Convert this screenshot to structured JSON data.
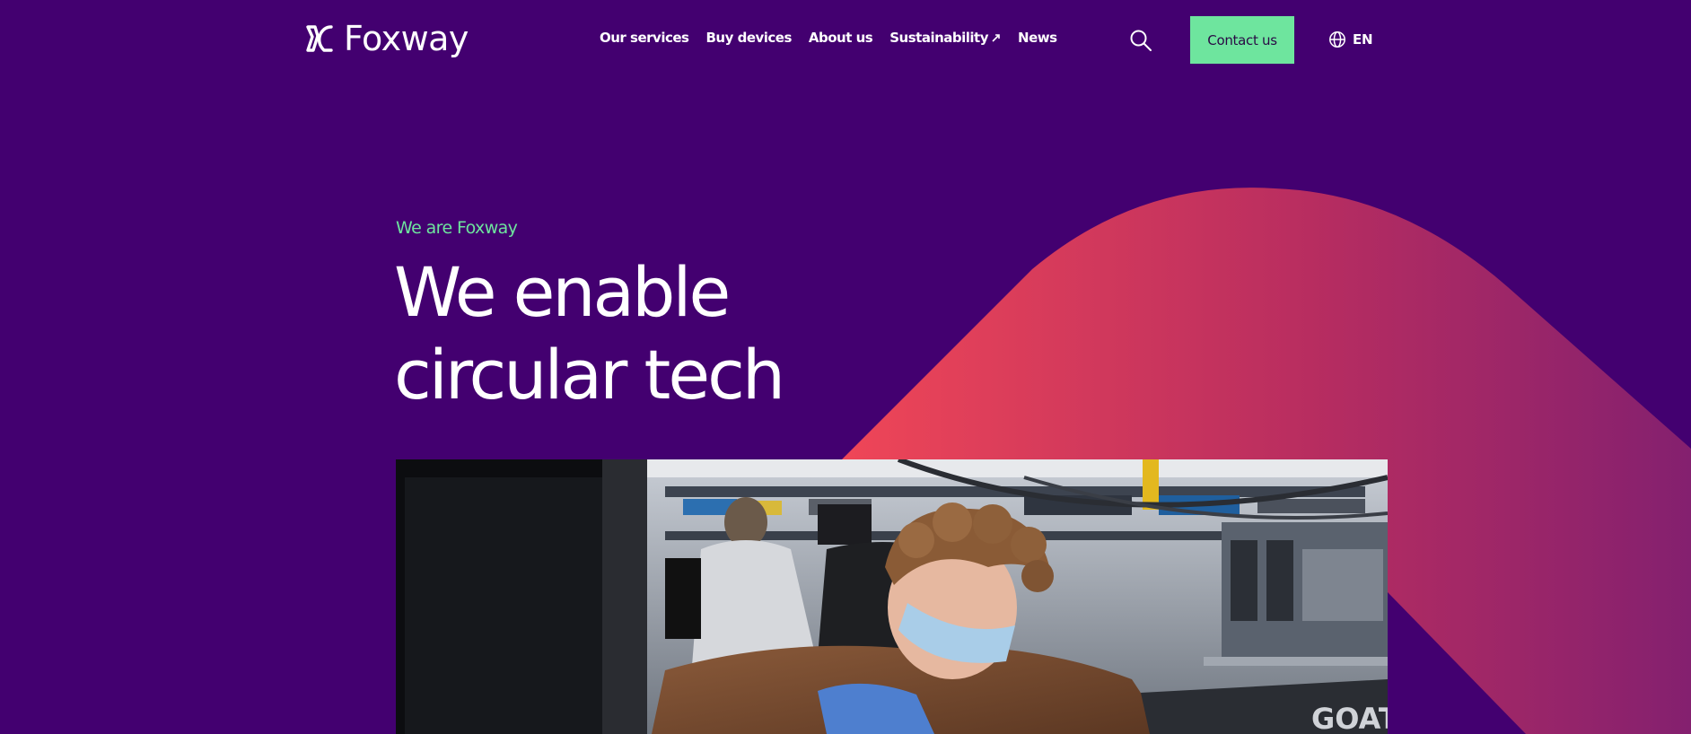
{
  "brand": {
    "name": "Foxway",
    "logo_icon": "foxway-logo-icon"
  },
  "nav": {
    "items": [
      {
        "label": "Our services"
      },
      {
        "label": "Buy devices"
      },
      {
        "label": "About us"
      },
      {
        "label": "Sustainability",
        "icon": "external-link-icon"
      },
      {
        "label": "News"
      }
    ]
  },
  "header": {
    "search_icon": "search-icon",
    "contact_label": "Contact us",
    "language_icon": "globe-icon",
    "language_label": "EN"
  },
  "hero": {
    "eyebrow": "We are Foxway",
    "headline_line1": "We enable",
    "headline_line2": "circular tech",
    "photo_text": "GOAT"
  },
  "colors": {
    "background": "#430070",
    "accent_green": "#6ee59e",
    "arch_start": "#ef4657",
    "arch_end": "#8a1f6e"
  }
}
